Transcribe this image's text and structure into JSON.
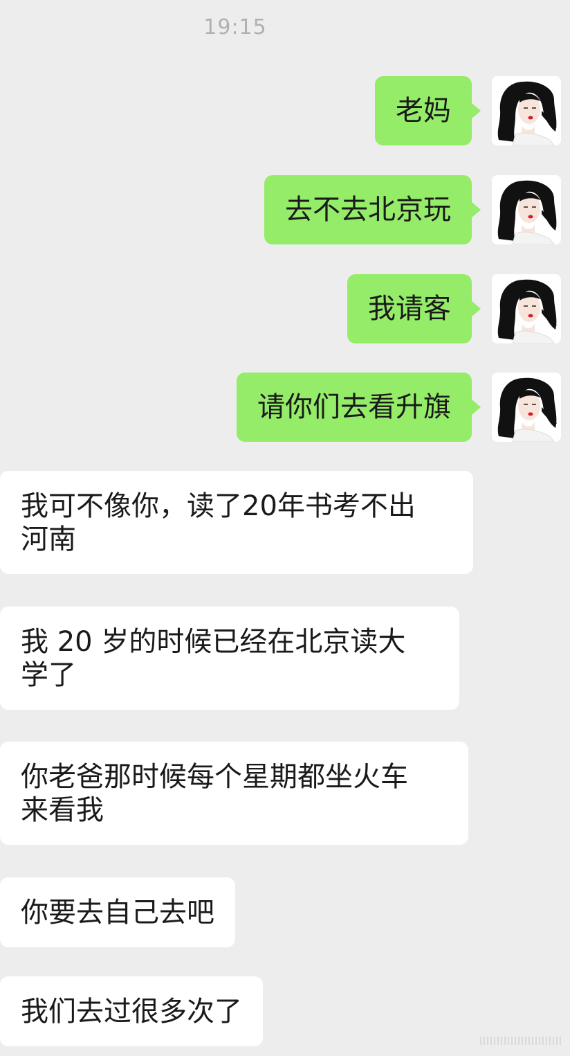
{
  "chat": {
    "timestamp": "19:15",
    "outgoing": [
      {
        "text": "老妈"
      },
      {
        "text": "去不去北京玩"
      },
      {
        "text": "我请客"
      },
      {
        "text": "请你们去看升旗"
      }
    ],
    "incoming": [
      {
        "lines": [
          "我可不像你，读了20年书考不出",
          "河南"
        ]
      },
      {
        "lines": [
          "我 20 岁的时候已经在北京读大",
          "学了"
        ]
      },
      {
        "lines": [
          "你老爸那时候每个星期都坐火车",
          "来看我"
        ]
      },
      {
        "lines": [
          "你要去自己去吧"
        ]
      },
      {
        "lines": [
          "我们去过很多次了"
        ]
      }
    ]
  },
  "colors": {
    "background": "#ededed",
    "outgoing_bubble": "#95ec69",
    "incoming_bubble": "#ffffff",
    "timestamp_text": "#b0b0b0"
  },
  "icons": {
    "avatar": "woman-portrait-avatar"
  }
}
